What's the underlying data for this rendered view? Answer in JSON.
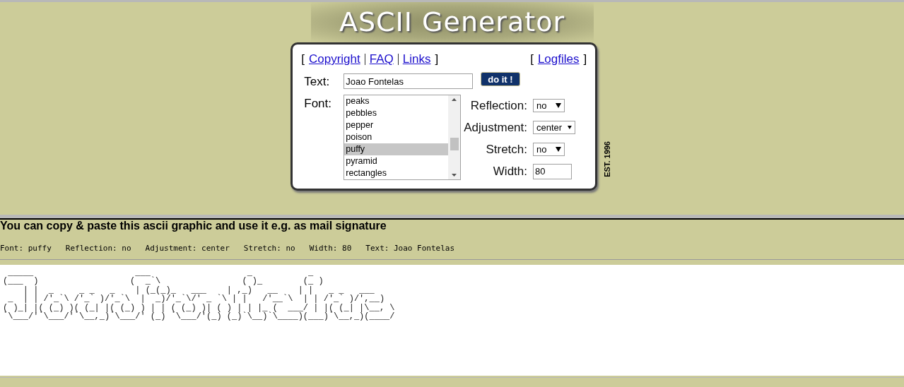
{
  "header": {
    "title": "ASCII Generator",
    "est": "EST. 1996"
  },
  "links": {
    "open": "[",
    "close": "]",
    "open_right": "[",
    "close_right": "]",
    "left": [
      {
        "label": "Copyright"
      },
      {
        "label": "FAQ"
      },
      {
        "label": "Links"
      }
    ],
    "right": [
      {
        "label": "Logfiles"
      }
    ]
  },
  "form": {
    "text_label": "Text:",
    "text_value": "Joao Fontelas",
    "submit": "do it !",
    "font_label": "Font:",
    "fonts": [
      {
        "label": "peaks",
        "selected": false
      },
      {
        "label": "pebbles",
        "selected": false
      },
      {
        "label": "pepper",
        "selected": false
      },
      {
        "label": "poison",
        "selected": false
      },
      {
        "label": "puffy",
        "selected": true
      },
      {
        "label": "pyramid",
        "selected": false
      },
      {
        "label": "rectangles",
        "selected": false
      }
    ],
    "options": [
      {
        "kind": "select",
        "label": "Reflection:",
        "value": "no"
      },
      {
        "kind": "select",
        "label": "Adjustment:",
        "value": "center"
      },
      {
        "kind": "select",
        "label": "Stretch:",
        "value": "no"
      },
      {
        "kind": "input",
        "label": "Width:",
        "value": "80"
      }
    ]
  },
  "result": {
    "heading": "You can copy & paste this ascii graphic and use it e.g. as mail signature",
    "info": [
      {
        "label": "Font:",
        "value": "puffy"
      },
      {
        "label": "Reflection:",
        "value": "no"
      },
      {
        "label": "Adjustment:",
        "value": "center"
      },
      {
        "label": "Stretch:",
        "value": "no"
      },
      {
        "label": "Width:",
        "value": "80"
      },
      {
        "label": "Text:",
        "value": "Joao Fontelas"
      }
    ],
    "ascii_art": [
      " _____                    ___                   _           _",
      "(___  )                  (  _`\\                ( )_        (_ )",
      "    | |  _     _ _   _    | (_(_)_   ___    | ,_)   __    | |   _ _   ___",
      " _  | | /'_`\\ /'_` )/'_`\\  |  _)/'_`\\/' _ `\\ | |   /'__`\\  | | /'_` )/',__)",
      "( )_| |( (_) )( (_| |( (_) ) | | ( (_) )| ( ) | | |_ (  ___/ | |( (_| |\\__, \\",
      "`\\___/'`\\___/'`\\__,_)`\\___/' (_) `\\___/'(_) (_)`\\__)`\\____)(___)`\\__,_)(____/"
    ]
  }
}
